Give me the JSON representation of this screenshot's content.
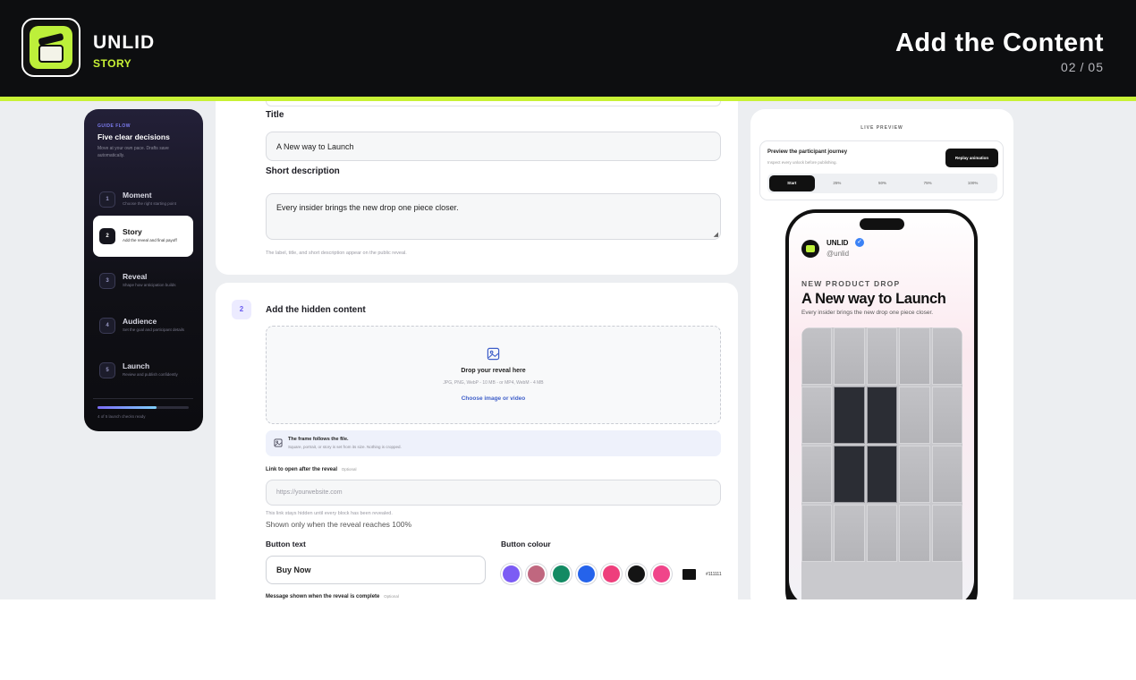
{
  "header": {
    "brand": "UNLID",
    "brand_sub": "STORY",
    "title": "Add the Content",
    "page_current": "02",
    "page_sep": "/",
    "page_total": "05"
  },
  "sidebar": {
    "eyebrow": "GUIDE FLOW",
    "heading": "Five clear decisions",
    "subtext": "Move at your own pace. Drafts save automatically.",
    "steps": [
      {
        "num": "1",
        "label": "Moment",
        "desc": "Choose the right starting point"
      },
      {
        "num": "2",
        "label": "Story",
        "desc": "Add the reveal and final payoff"
      },
      {
        "num": "3",
        "label": "Reveal",
        "desc": "Shape how anticipation builds"
      },
      {
        "num": "4",
        "label": "Audience",
        "desc": "Set the goal and participant details"
      },
      {
        "num": "5",
        "label": "Launch",
        "desc": "Review and publish confidently"
      }
    ],
    "progress": 0.65,
    "progress_caption": "4 of 5 launch checks ready"
  },
  "form": {
    "title_label": "Title",
    "title_value": "A New way to Launch",
    "desc_label": "Short description",
    "desc_value": "Every insider brings the new drop one piece closer.",
    "desc_helper": "The label, title, and short description appear on the public reveal.",
    "section2_num": "2",
    "section2_title": "Add the hidden content",
    "drop_title": "Drop your reveal here",
    "drop_formats": "JPG, PNG, WebP - 10 MB - or MP4, WebM - 4 MB",
    "drop_link": "Choose image or video",
    "info_title": "The frame follows the file.",
    "info_text": "Square, portrait, or story is set from its size. Nothing is cropped.",
    "link_label": "Link to open after the reveal",
    "link_optional": "Optional",
    "link_placeholder": "https://yourwebsite.com",
    "link_helper": "This link stays hidden until every block has been revealed.",
    "link_note": "Shown only when the reveal reaches 100%",
    "button_text_label": "Button text",
    "button_text_value": "Buy Now",
    "button_colour_label": "Button colour",
    "swatches": [
      "#7c5cf4",
      "#c0677f",
      "#138a63",
      "#2563eb",
      "#ee3f7c",
      "#141414",
      "#f0458a"
    ],
    "colour_hex": "#111111",
    "message_label": "Message shown when the reveal is complete",
    "message_optional": "Optional"
  },
  "preview": {
    "eyebrow": "LIVE PREVIEW",
    "journey_title": "Preview the participant journey",
    "journey_sub": "Inspect every unlock before publishing.",
    "replay_label": "Replay animation",
    "tabs": [
      "Start",
      "25%",
      "50%",
      "75%",
      "100%"
    ],
    "account_name": "UNLID",
    "account_handle": "@unlid",
    "kicker": "NEW PRODUCT DROP",
    "headline": "A New way to Launch",
    "subline": "Every insider brings the new drop one piece closer."
  }
}
